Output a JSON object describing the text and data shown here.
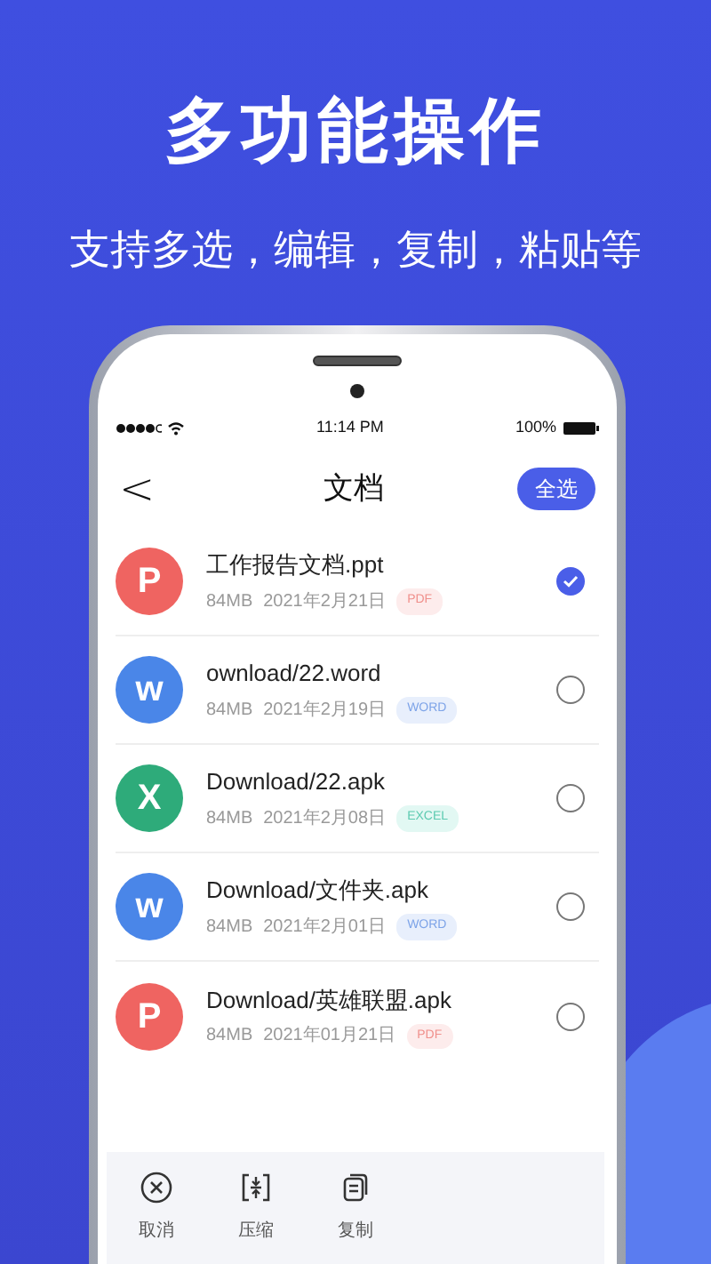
{
  "headline": "多功能操作",
  "subtitle": "支持多选，编辑，复制，粘贴等",
  "status_bar": {
    "time": "11:14 PM",
    "battery": "100%"
  },
  "nav": {
    "back": "<",
    "title": "文档",
    "action": "全选"
  },
  "files": [
    {
      "letter": "P",
      "color": "#ef6461",
      "name": "工作报告文档.ppt",
      "size": "84MB",
      "date": "2021年2月21日",
      "tag": "PDF",
      "kind": "pdf",
      "selected": true
    },
    {
      "letter": "w",
      "color": "#4a86e8",
      "name": "ownload/22.word",
      "size": "84MB",
      "date": "2021年2月19日",
      "tag": "WORD",
      "kind": "word",
      "selected": false
    },
    {
      "letter": "X",
      "color": "#2eab7a",
      "name": "Download/22.apk",
      "size": "84MB",
      "date": "2021年2月08日",
      "tag": "EXCEL",
      "kind": "excel",
      "selected": false
    },
    {
      "letter": "w",
      "color": "#4a86e8",
      "name": "Download/文件夹.apk",
      "size": "84MB",
      "date": "2021年2月01日",
      "tag": "WORD",
      "kind": "word",
      "selected": false
    },
    {
      "letter": "P",
      "color": "#ef6461",
      "name": "Download/英雄联盟.apk",
      "size": "84MB",
      "date": "2021年01月21日",
      "tag": "PDF",
      "kind": "pdf",
      "selected": false
    }
  ],
  "toolbar": [
    {
      "kind": "cancel",
      "label": "取消"
    },
    {
      "kind": "compress",
      "label": "压缩"
    },
    {
      "kind": "copy",
      "label": "复制"
    }
  ]
}
